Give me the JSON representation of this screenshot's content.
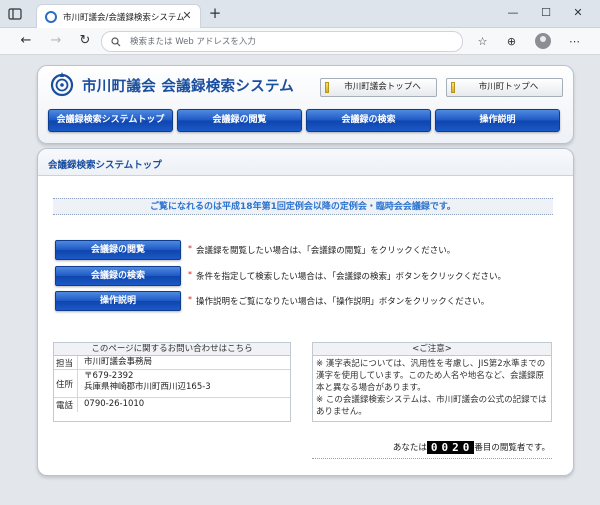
{
  "browser": {
    "tab_title": "市川町議会/会議録検索システム",
    "tab_close": "✕",
    "new_tab": "+",
    "address_placeholder": "検索または Web アドレスを入力",
    "address_value": "",
    "window_min": "—",
    "window_max": "☐",
    "window_close": "✕",
    "back": "←",
    "forward": "→",
    "reload": "↻",
    "favorites_icon": "☆",
    "collections_icon": "⊕",
    "menu_icon": "⋯"
  },
  "header": {
    "site_title": "市川町議会  会議録検索システム",
    "links": [
      "市川町議会トップへ",
      "市川町トップへ"
    ],
    "nav": [
      "会議録検索システムトップ",
      "会議録の閲覧",
      "会議録の検索",
      "操作説明"
    ]
  },
  "main": {
    "section_title": "会議録検索システムトップ",
    "notice": "ご覧になれるのは平成18年第1回定例会以降の定例会・臨時会会議録です。",
    "actions": [
      {
        "label": "会議録の閲覧",
        "mark": "*",
        "desc": "会議録を閲覧したい場合は、「会議録の閲覧」をクリックください。"
      },
      {
        "label": "会議録の検索",
        "mark": "*",
        "desc": "条件を指定して検索したい場合は、「会議録の検索」ボタンをクリックください。"
      },
      {
        "label": "操作説明",
        "mark": "*",
        "desc": "操作説明をご覧になりたい場合は、「操作説明」ボタンをクリックください。"
      }
    ],
    "contact": {
      "heading": "このページに関するお問い合わせはこちら",
      "rows": [
        {
          "key": "担当",
          "lines": [
            "市川町議会事務局"
          ]
        },
        {
          "key": "住所",
          "lines": [
            "〒679-2392",
            "兵庫県神崎郡市川町西川辺165-3"
          ]
        },
        {
          "key": "電話",
          "lines": [
            "0790-26-1010"
          ]
        }
      ]
    },
    "caution": {
      "heading": "<ご注意>",
      "lines": [
        "※ 漢字表記については、汎用性を考慮し、JIS第2水準までの漢字を使用しています。このため人名や地名など、会議録原本と異なる場合があります。",
        "※ この会議録検索システムは、市川町議会の公式の記録ではありません。"
      ]
    },
    "counter": {
      "prefix": "あなたは",
      "digits": "0020",
      "suffix": "番目の閲覧者です。"
    }
  },
  "colors": {
    "accent": "#1a4e9e",
    "button_blue": "#1d58c4",
    "notice_text": "#2b73d1",
    "mark_red": "#d62020"
  }
}
